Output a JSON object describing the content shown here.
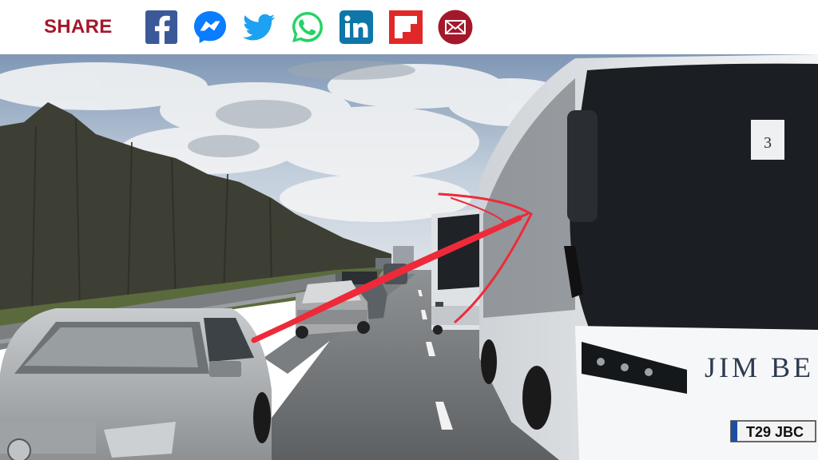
{
  "share": {
    "label": "SHARE",
    "buttons": [
      {
        "name": "facebook",
        "icon": "facebook-icon",
        "color": "#3b5998"
      },
      {
        "name": "messenger",
        "icon": "messenger-icon",
        "color": "#0a7cff"
      },
      {
        "name": "twitter",
        "icon": "twitter-icon",
        "color": "#1da1f2"
      },
      {
        "name": "whatsapp",
        "icon": "whatsapp-icon",
        "color": "#25d366"
      },
      {
        "name": "linkedin",
        "icon": "linkedin-icon",
        "color": "#0e76a8"
      },
      {
        "name": "flipboard",
        "icon": "flipboard-icon",
        "color": "#e12828"
      },
      {
        "name": "email",
        "icon": "email-icon",
        "color": "#a3182b"
      }
    ]
  },
  "photo": {
    "bus_sign_number": "3",
    "coach_livery": "JIM BE",
    "number_plate": "T29 JBC",
    "annotation_color": "#ee2a3a"
  }
}
